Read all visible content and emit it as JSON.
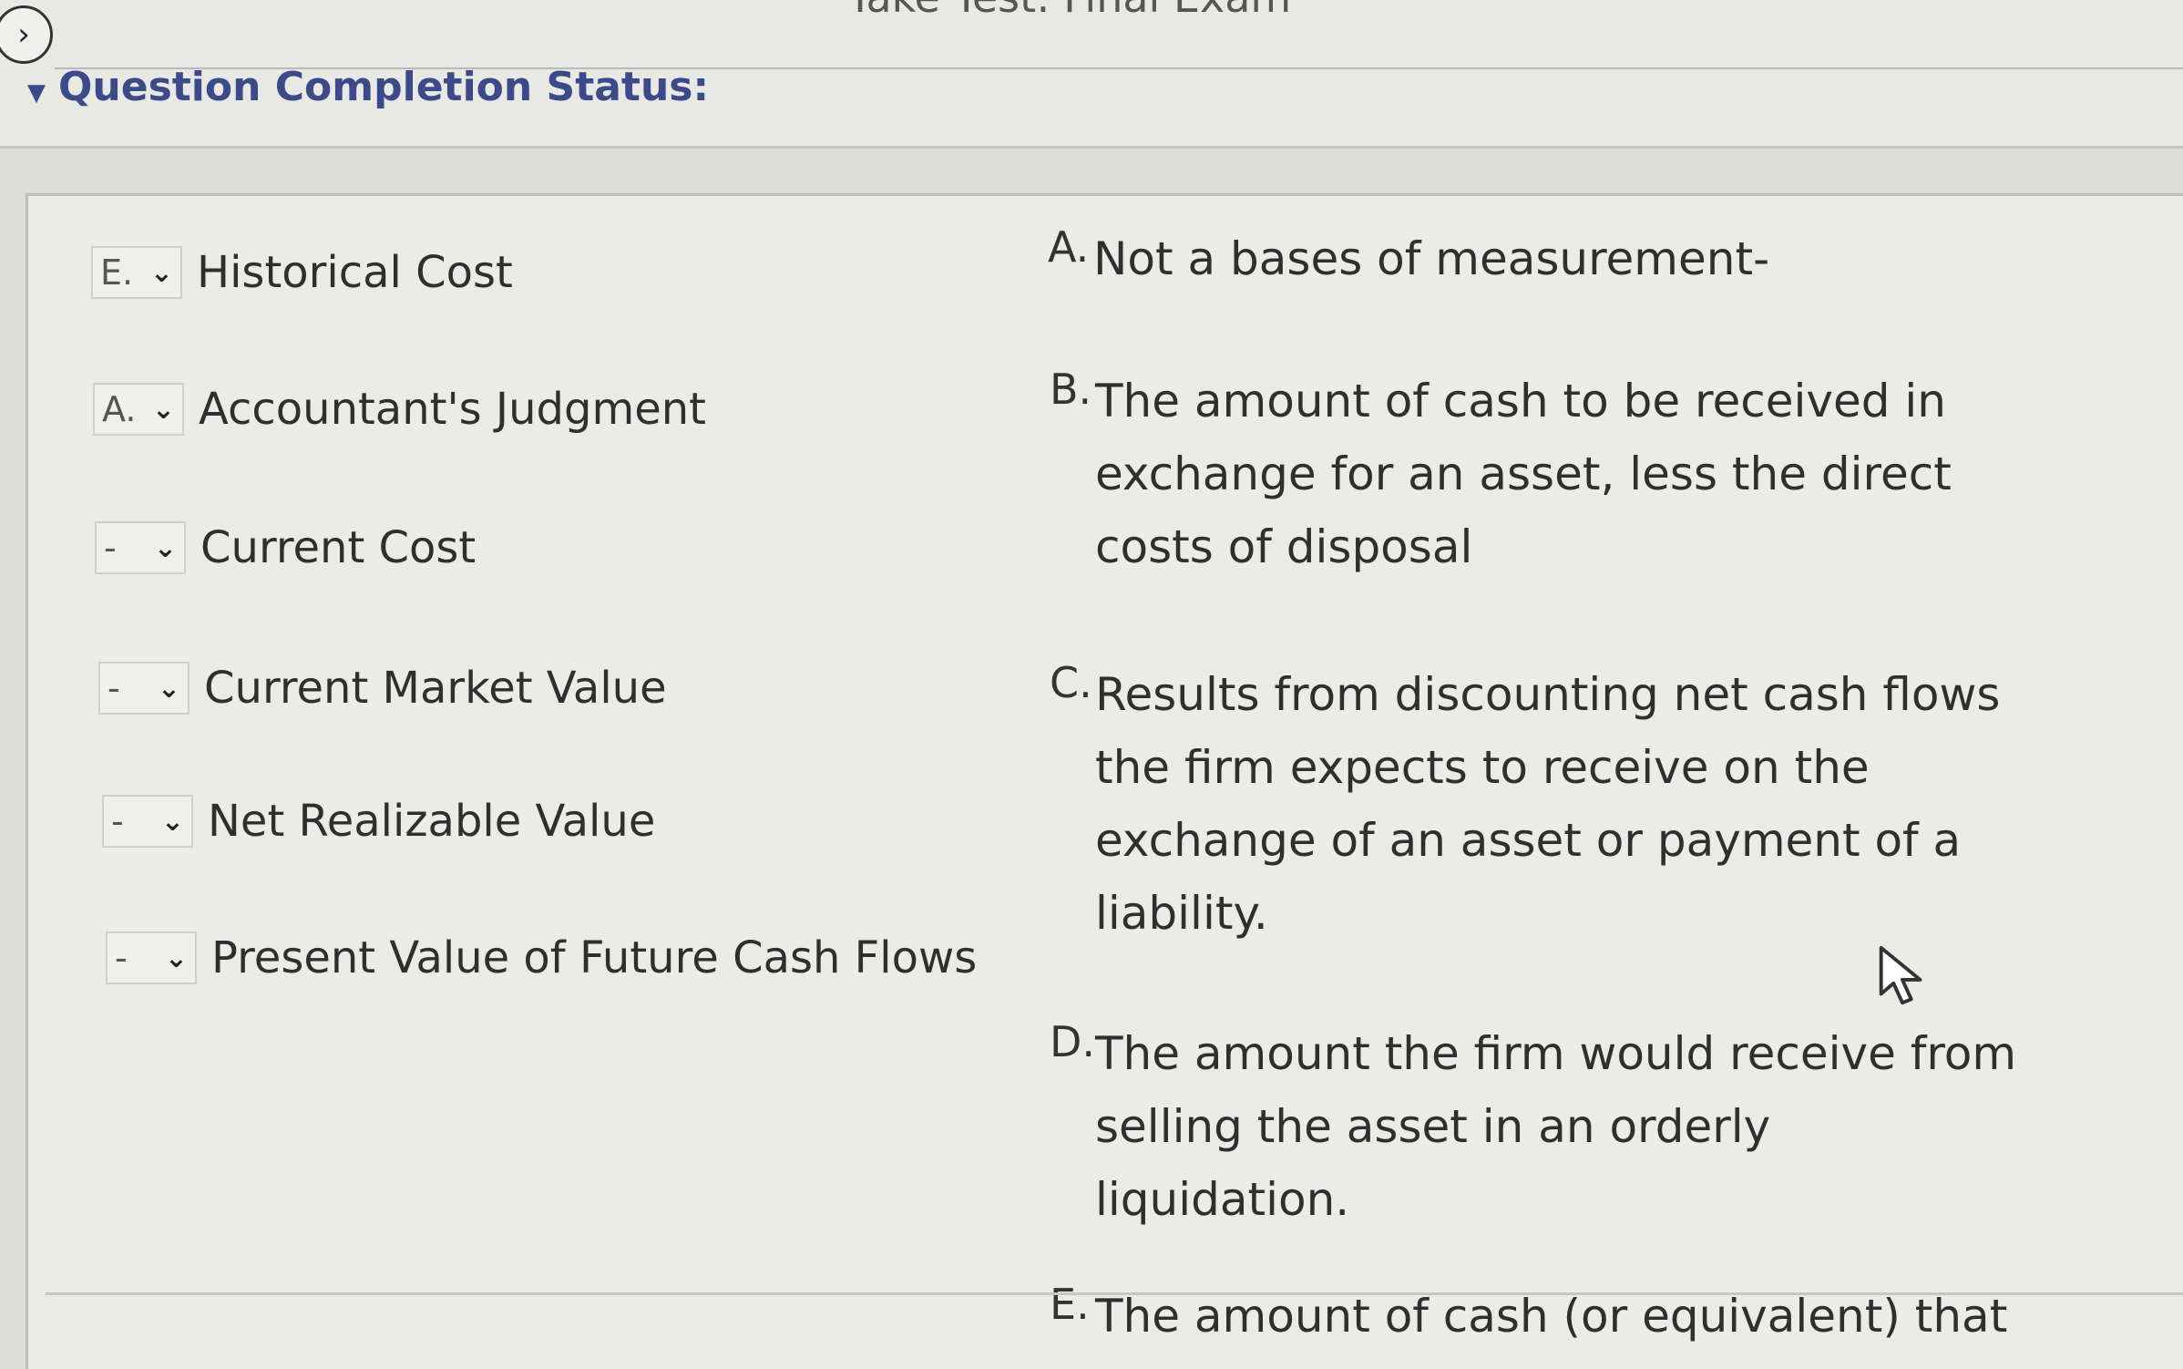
{
  "header": {
    "page_title": "Take Test: Final Exam",
    "status_label": "Question Completion Status:",
    "nav_icon": "chevron-right-icon"
  },
  "matching": {
    "items": [
      {
        "selected": "E.",
        "term": "Historical Cost"
      },
      {
        "selected": "A.",
        "term": "Accountant's Judgment"
      },
      {
        "selected": "-",
        "term": "Current Cost"
      },
      {
        "selected": "-",
        "term": "Current Market Value"
      },
      {
        "selected": "-",
        "term": "Net Realizable Value"
      },
      {
        "selected": "-",
        "term": "Present Value of Future Cash Flows"
      }
    ],
    "options": [
      {
        "letter": "A.",
        "text": "Not a bases of measurement-"
      },
      {
        "letter": "B.",
        "text": "The amount of cash to be received in exchange for an asset, less the direct costs of disposal"
      },
      {
        "letter": "C.",
        "text": "Results from discounting net cash flows the firm expects  to receive on the exchange of an asset or payment of a liability."
      },
      {
        "letter": "D.",
        "text": "The amount the firm would receive from selling the asset in an orderly liquidation."
      },
      {
        "letter": "E.",
        "text": "The amount of cash (or equivalent) that"
      }
    ]
  }
}
